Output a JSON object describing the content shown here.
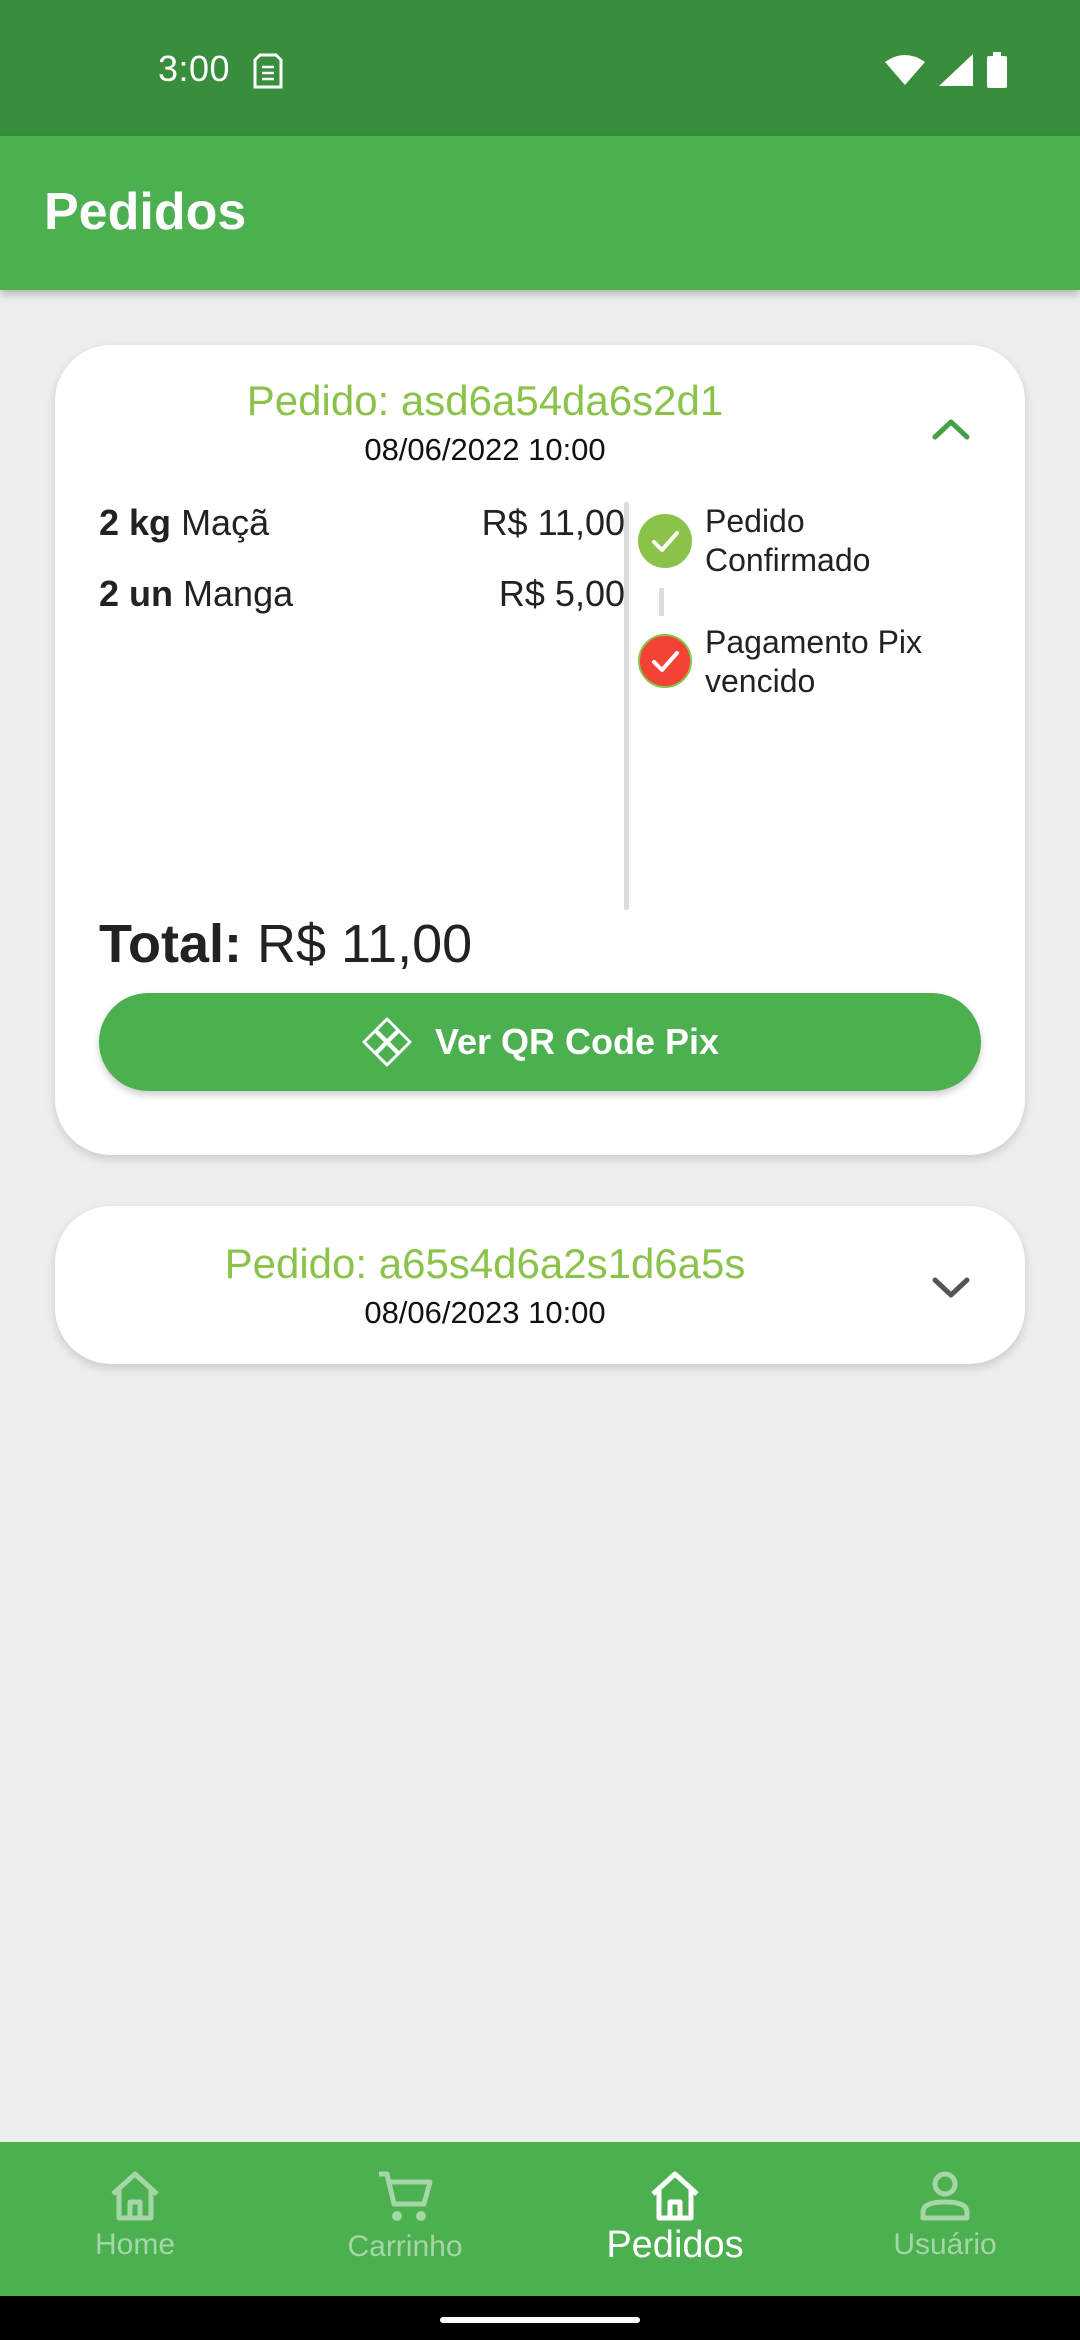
{
  "status_bar": {
    "time": "3:00"
  },
  "app_bar": {
    "title": "Pedidos"
  },
  "orders": [
    {
      "id_label": "Pedido: asd6a54da6s2d1",
      "date": "08/06/2022 10:00",
      "expanded": true,
      "items": [
        {
          "qty": "2 kg",
          "name": "Maçã",
          "price": "R$ 11,00"
        },
        {
          "qty": "2 un",
          "name": "Manga",
          "price": "R$ 5,00"
        }
      ],
      "steps": [
        {
          "line1": "Pedido",
          "line2": "Confirmado",
          "status": "ok",
          "color": "#8BC34A"
        },
        {
          "line1": "Pagamento Pix",
          "line2": "vencido",
          "status": "error",
          "color": "#F44336"
        }
      ],
      "total_label": "Total:",
      "total_value": "R$ 11,00",
      "qr_button_label": "Ver QR Code Pix"
    },
    {
      "id_label": "Pedido: a65s4d6a2s1d6a5s",
      "date": "08/06/2023 10:00",
      "expanded": false
    }
  ],
  "bottom_nav": {
    "items": [
      {
        "label": "Home",
        "icon": "home-icon",
        "active": false
      },
      {
        "label": "Carrinho",
        "icon": "cart-icon",
        "active": false
      },
      {
        "label": "Pedidos",
        "icon": "orders-home-icon",
        "active": true
      },
      {
        "label": "Usuário",
        "icon": "user-icon",
        "active": false
      }
    ]
  },
  "colors": {
    "status_bar": "#388E3C",
    "primary": "#4CAF50",
    "accent_light": "#8BC34A",
    "error": "#F44336",
    "background": "#EEEEEE"
  }
}
